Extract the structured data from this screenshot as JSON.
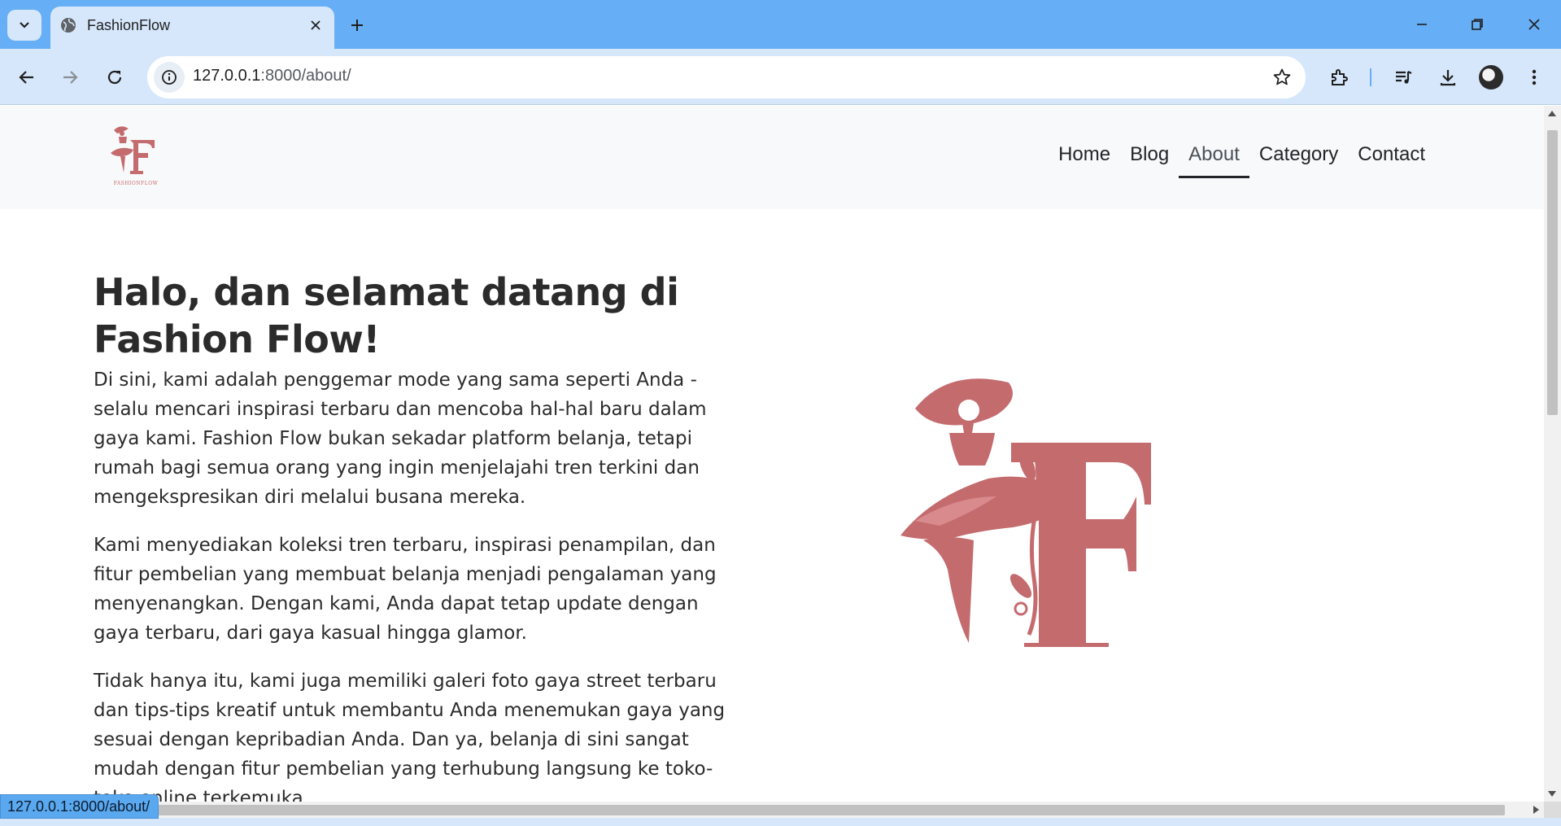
{
  "browser": {
    "tab_title": "FashionFlow",
    "url_host": "127.0.0.1",
    "url_path": ":8000/about/",
    "status_url": "127.0.0.1:8000/about/",
    "accent": "#66aef5",
    "toolbar_bg": "#d6e7fb"
  },
  "navbar": {
    "brand_text": "FASHIONFLOW",
    "links": [
      {
        "label": "Home"
      },
      {
        "label": "Blog"
      },
      {
        "label": "About",
        "active": true
      },
      {
        "label": "Category"
      },
      {
        "label": "Contact"
      }
    ]
  },
  "main": {
    "heading": "Halo, dan selamat datang di Fashion Flow!",
    "paragraphs": [
      "Di sini, kami adalah penggemar mode yang sama seperti Anda - selalu mencari inspirasi terbaru dan mencoba hal-hal baru dalam gaya kami. Fashion Flow bukan sekadar platform belanja, tetapi rumah bagi semua orang yang ingin menjelajahi tren terkini dan mengekspresikan diri melalui busana mereka.",
      "Kami menyediakan koleksi tren terbaru, inspirasi penampilan, dan fitur pembelian yang membuat belanja menjadi pengalaman yang menyenangkan. Dengan kami, Anda dapat tetap update dengan gaya terbaru, dari gaya kasual hingga glamor.",
      "Tidak hanya itu, kami juga memiliki galeri foto gaya street terbaru dan tips-tips kreatif untuk membantu Anda menemukan gaya yang sesuai dengan kepribadian Anda. Dan ya, belanja di sini sangat mudah dengan fitur pembelian yang terhubung langsung ke toko-toko online terkemuka."
    ],
    "logo_color": "#c46b6e"
  }
}
